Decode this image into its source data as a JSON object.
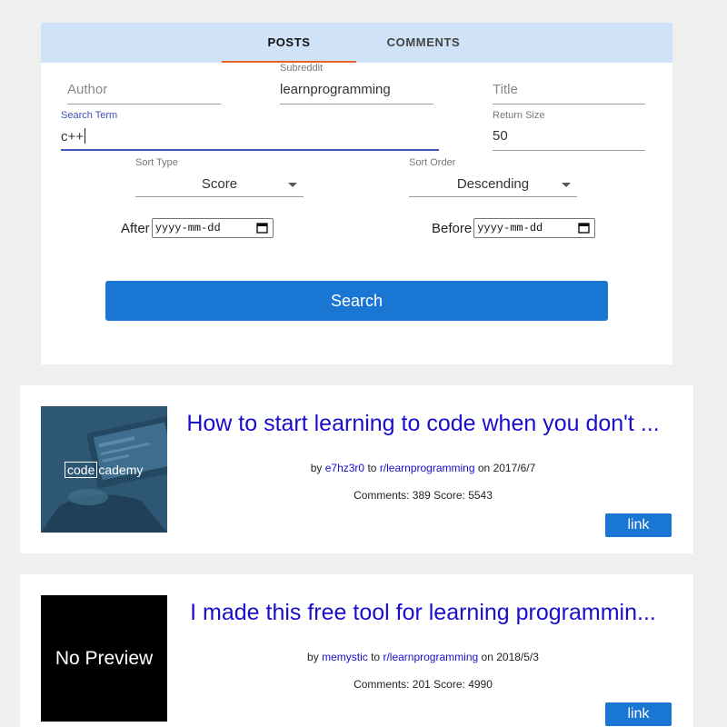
{
  "tabs": {
    "posts_label": "POSTS",
    "comments_label": "COMMENTS"
  },
  "form": {
    "author": {
      "placeholder": "Author",
      "value": ""
    },
    "subreddit": {
      "label": "Subreddit",
      "value": "learnprogramming"
    },
    "title": {
      "placeholder": "Title",
      "value": ""
    },
    "search_term": {
      "label": "Search Term",
      "value": "c++"
    },
    "return_size": {
      "label": "Return Size",
      "value": "50"
    },
    "sort_type": {
      "label": "Sort Type",
      "value": "Score"
    },
    "sort_order": {
      "label": "Sort Order",
      "value": "Descending"
    },
    "after": {
      "label": "After",
      "placeholder": "yyyy-mm-dd"
    },
    "before": {
      "label": "Before",
      "placeholder": "yyyy-mm-dd"
    },
    "search_label": "Search"
  },
  "results": [
    {
      "thumbnail": {
        "type": "image",
        "logo_code": "code",
        "logo_rest": "cademy"
      },
      "title": "How to start learning to code when you don't ...",
      "by_text": "by",
      "author": "e7hz3r0",
      "to_text": "to",
      "subreddit": "r/learnprogramming",
      "on_text": "on",
      "date": "2017/6/7",
      "comments_label": "Comments:",
      "comments": "389",
      "score_label": "Score:",
      "score": "5543",
      "link_label": "link"
    },
    {
      "thumbnail": {
        "type": "none",
        "text": "No Preview"
      },
      "title": "I made this free tool for learning programmin...",
      "by_text": "by",
      "author": "memystic",
      "to_text": "to",
      "subreddit": "r/learnprogramming",
      "on_text": "on",
      "date": "2018/5/3",
      "comments_label": "Comments:",
      "comments": "201",
      "score_label": "Score:",
      "score": "4990",
      "link_label": "link"
    }
  ],
  "colors": {
    "tab_bar": "#cfe2f7",
    "tab_indicator": "#e8622c",
    "primary": "#1976d2",
    "link": "#1a0dcc",
    "focus": "#3f51b5"
  }
}
